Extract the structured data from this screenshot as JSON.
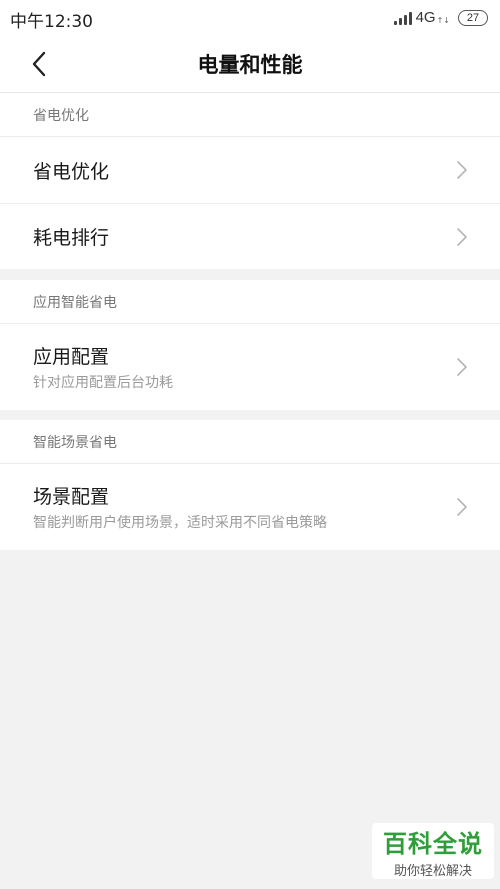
{
  "status_bar": {
    "time": "中午12:30",
    "network": "4G",
    "network_sub": "↑↓",
    "battery": "27"
  },
  "header": {
    "title": "电量和性能",
    "back_icon": "chevron-left-icon"
  },
  "sections": [
    {
      "header": "省电优化",
      "items": [
        {
          "title": "省电优化"
        },
        {
          "title": "耗电排行"
        }
      ]
    },
    {
      "header": "应用智能省电",
      "items": [
        {
          "title": "应用配置",
          "subtitle": "针对应用配置后台功耗"
        }
      ]
    },
    {
      "header": "智能场景省电",
      "items": [
        {
          "title": "场景配置",
          "subtitle": "智能判断用户使用场景，适时采用不同省电策略"
        }
      ]
    }
  ],
  "watermark": {
    "main": "百科全说",
    "sub": "助你轻松解决"
  },
  "colors": {
    "background": "#f2f2f2",
    "watermark_green": "#2e9e3a"
  }
}
